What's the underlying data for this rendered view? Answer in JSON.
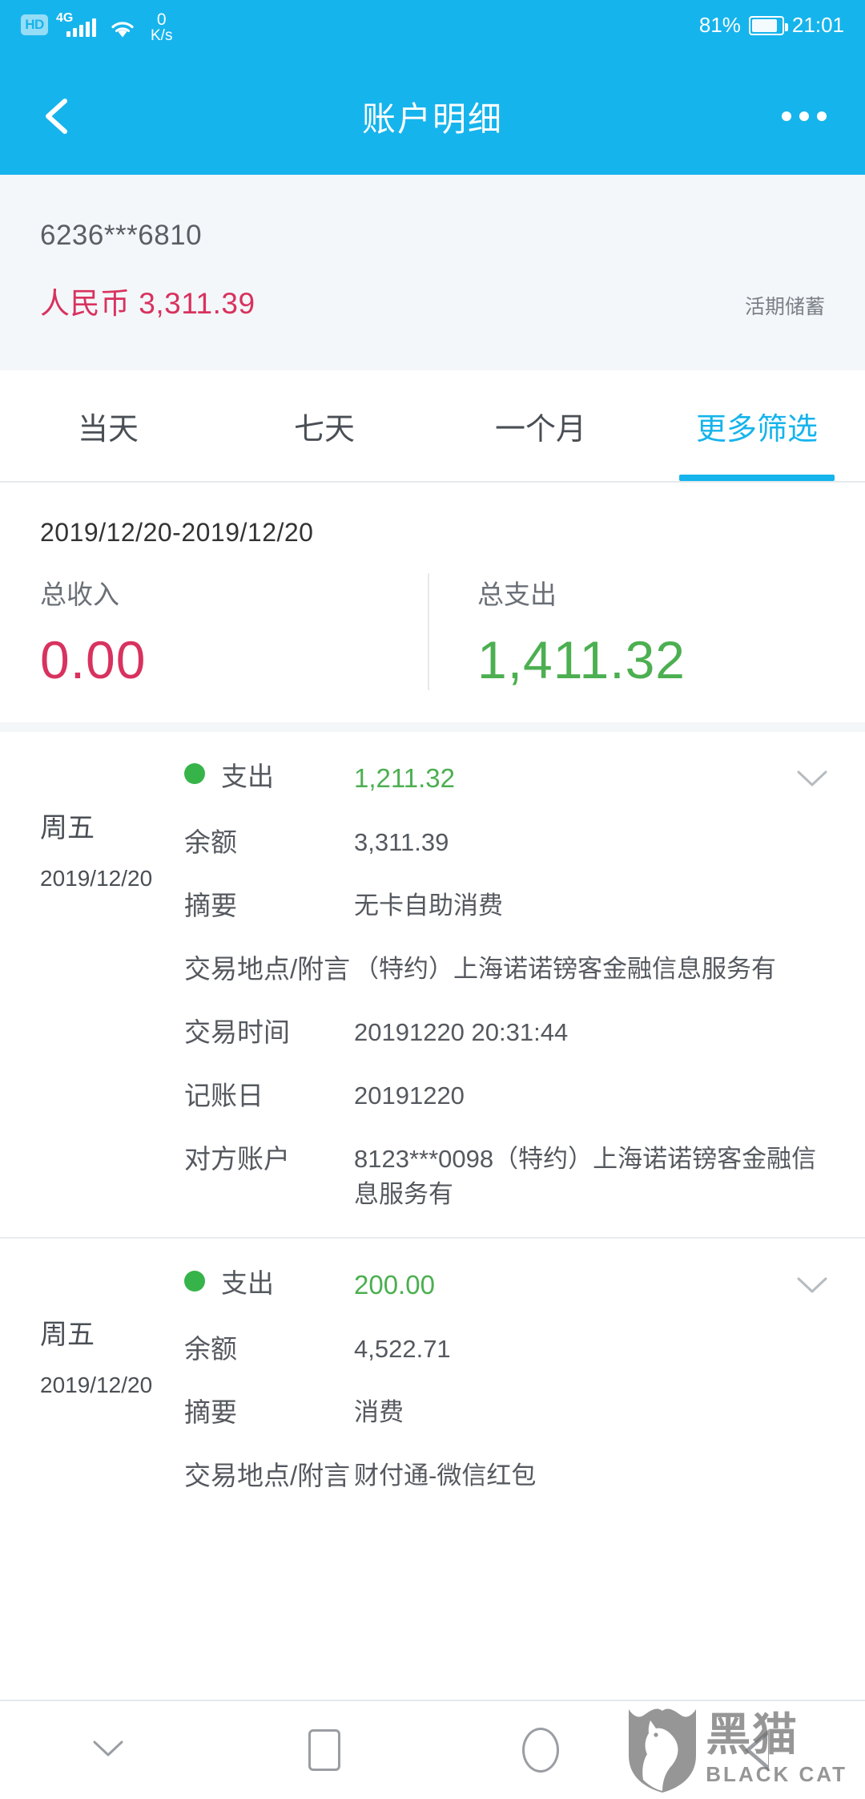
{
  "status_bar": {
    "hd_badge": "HD",
    "network_type": "4G",
    "wifi_icon": "wifi-icon",
    "net_speed_value": "0",
    "net_speed_unit": "K/s",
    "battery_percent": "81%",
    "time": "21:01"
  },
  "titlebar": {
    "back_icon": "back-chevron-icon",
    "title": "账户明细",
    "more_icon": "more-options-icon"
  },
  "account": {
    "number": "6236***6810",
    "currency_label": "人民币",
    "balance": "3,311.39",
    "type": "活期储蓄",
    "balance_color": "#d8325f"
  },
  "tabs": [
    {
      "label": "当天",
      "active": false
    },
    {
      "label": "七天",
      "active": false
    },
    {
      "label": "一个月",
      "active": false
    },
    {
      "label": "更多筛选",
      "active": true
    }
  ],
  "summary": {
    "date_range": "2019/12/20-2019/12/20",
    "income_label": "总收入",
    "income_value": "0.00",
    "income_color": "#d8325f",
    "expense_label": "总支出",
    "expense_value": "1,411.32",
    "expense_color": "#4caf50"
  },
  "transactions": [
    {
      "weekday": "周五",
      "date": "2019/12/20",
      "type_label": "支出",
      "amount": "1,211.32",
      "amount_color": "#4caf50",
      "expand_icon": "chevron-down-icon",
      "fields": [
        {
          "key": "余额",
          "value": "3,311.39"
        },
        {
          "key": "摘要",
          "value": "无卡自助消费"
        },
        {
          "key": "交易地点/附言",
          "value": "（特约）上海诺诺镑客金融信息服务有"
        },
        {
          "key": "交易时间",
          "value": "20191220 20:31:44"
        },
        {
          "key": "记账日",
          "value": "20191220"
        },
        {
          "key": "对方账户",
          "value": "8123***0098（特约）上海诺诺镑客金融信息服务有"
        }
      ]
    },
    {
      "weekday": "周五",
      "date": "2019/12/20",
      "type_label": "支出",
      "amount": "200.00",
      "amount_color": "#4caf50",
      "expand_icon": "chevron-down-icon",
      "fields": [
        {
          "key": "余额",
          "value": "4,522.71"
        },
        {
          "key": "摘要",
          "value": "消费"
        },
        {
          "key": "交易地点/附言",
          "value": "财付通-微信红包"
        }
      ]
    }
  ],
  "navbar": {
    "hide_keyboard_icon": "chevron-down-icon",
    "recents_icon": "square-icon",
    "home_icon": "circle-icon",
    "back_icon": "triangle-left-icon"
  },
  "watermark": {
    "logo_icon": "black-cat-shield-logo",
    "name_cn": "黑猫",
    "name_en": "BLACK CAT"
  },
  "theme": {
    "accent": "#16b4ec",
    "panel_bg": "#f4f7f9"
  }
}
